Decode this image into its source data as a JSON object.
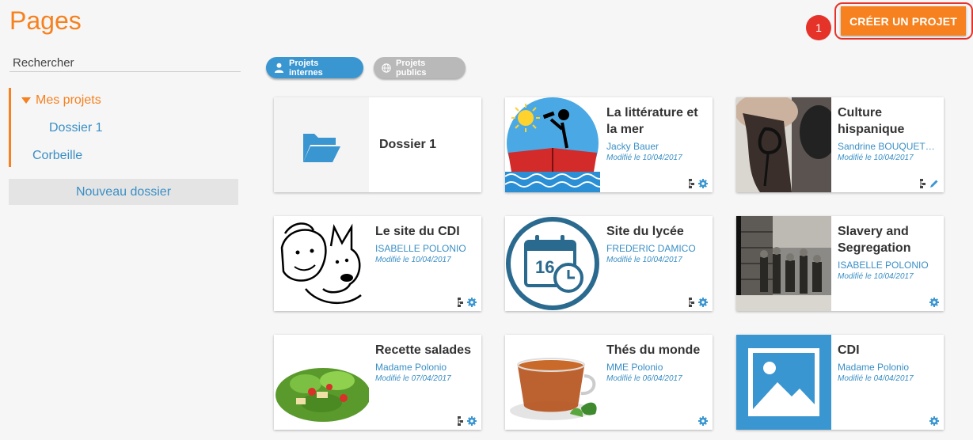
{
  "page": {
    "title": "Pages"
  },
  "header": {
    "create_label": "CRÉER UN PROJET",
    "step_badge": "1"
  },
  "sidebar": {
    "search_placeholder": "Rechercher",
    "items": [
      {
        "label": "Mes projets"
      },
      {
        "label": "Dossier 1"
      },
      {
        "label": "Corbeille"
      }
    ],
    "new_folder_label": "Nouveau dossier"
  },
  "filters": [
    {
      "label": "Projets internes",
      "icon": "user-icon",
      "active": true
    },
    {
      "label": "Projets publics",
      "icon": "globe-icon",
      "active": false
    }
  ],
  "folder_card": {
    "title": "Dossier 1",
    "icon": "folder-open-icon"
  },
  "cards": [
    {
      "title": "La littérature et la mer",
      "author": "Jacky Bauer",
      "date": "Modifié le 10/04/2017"
    },
    {
      "title": "Culture hispanique",
      "author": "Sandrine BOUQUETY (...",
      "date": "Modifié le 10/04/2017"
    },
    {
      "title": "Le site du CDI",
      "author": "ISABELLE POLONIO",
      "date": "Modifié le 10/04/2017"
    },
    {
      "title": "Site du lycée",
      "author": "FREDERIC DAMICO",
      "date": "Modifié le 10/04/2017"
    },
    {
      "title": "Slavery and Segregation",
      "author": "ISABELLE POLONIO",
      "date": "Modifié le 10/04/2017"
    },
    {
      "title": "Recette salades",
      "author": "Madame Polonio",
      "date": "Modifié le 07/04/2017"
    },
    {
      "title": "Thés du monde",
      "author": "MME Polonio",
      "date": "Modifié le 06/04/2017"
    },
    {
      "title": "CDI",
      "author": "Madame Polonio",
      "date": "Modifié le 04/04/2017"
    }
  ],
  "colors": {
    "accent": "#f6811e",
    "link": "#3a8fc5",
    "badge": "#e5332a",
    "toggle_active": "#3a96d0"
  }
}
